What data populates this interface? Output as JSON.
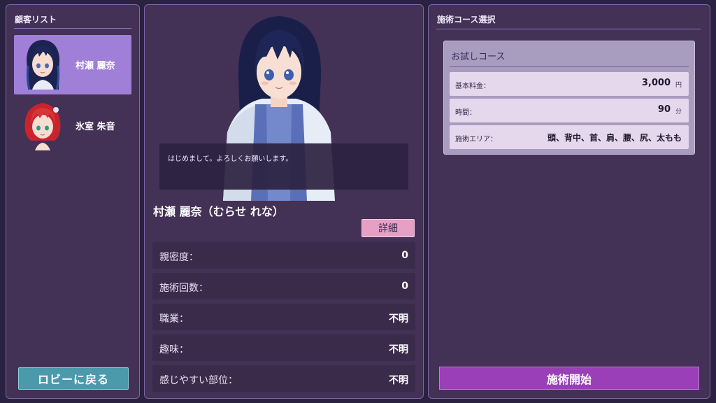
{
  "left_panel": {
    "title": "顧客リスト",
    "customers": [
      {
        "name": "村瀬 麗奈",
        "selected": true,
        "hair_color": "#1c2350"
      },
      {
        "name": "氷室 朱音",
        "selected": false,
        "hair_color": "#c8242e"
      }
    ],
    "lobby_button": "ロビーに戻る"
  },
  "center_panel": {
    "dialog": "はじめまして。よろしくお願いします。",
    "character_name": "村瀬 麗奈（むらせ れな）",
    "detail_button": "詳細",
    "stats": [
      {
        "label": "親密度：",
        "value": "0"
      },
      {
        "label": "施術回数：",
        "value": "0"
      },
      {
        "label": "職業：",
        "value": "不明"
      },
      {
        "label": "趣味：",
        "value": "不明"
      },
      {
        "label": "感じやすい部位：",
        "value": "不明"
      }
    ]
  },
  "right_panel": {
    "title": "施術コース選択",
    "course": {
      "title": "お試しコース",
      "rows": [
        {
          "label": "基本料金：",
          "value": "3,000",
          "unit": "円"
        },
        {
          "label": "時間：",
          "value": "90",
          "unit": "分"
        },
        {
          "label": "施術エリア：",
          "value": "頭、背中、首、肩、腰、尻、太もも"
        }
      ]
    },
    "start_button": "施術開始"
  },
  "colors": {
    "background": "#2b2140",
    "panel": "#433156",
    "selected_item": "#a07fd8",
    "lobby_button": "#4b9aac",
    "detail_button": "#e6a0c4",
    "start_button": "#9a3fb8"
  }
}
